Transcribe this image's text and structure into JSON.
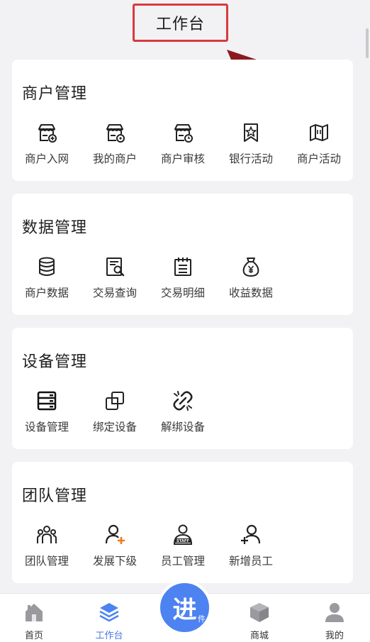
{
  "header": {
    "title": "工作台"
  },
  "sections": [
    {
      "title": "商户管理",
      "items": [
        {
          "label": "商户入网",
          "icon": "store-add-icon"
        },
        {
          "label": "我的商户",
          "icon": "store-gear-icon"
        },
        {
          "label": "商户审核",
          "icon": "store-clock-icon"
        },
        {
          "label": "银行活动",
          "icon": "star-flag-icon"
        },
        {
          "label": "商户活动",
          "icon": "map-icon"
        }
      ]
    },
    {
      "title": "数据管理",
      "items": [
        {
          "label": "商户数据",
          "icon": "database-icon"
        },
        {
          "label": "交易查询",
          "icon": "search-document-icon"
        },
        {
          "label": "交易明细",
          "icon": "clipboard-list-icon"
        },
        {
          "label": "收益数据",
          "icon": "money-bag-icon"
        }
      ]
    },
    {
      "title": "设备管理",
      "items": [
        {
          "label": "设备管理",
          "icon": "server-icon"
        },
        {
          "label": "绑定设备",
          "icon": "link-squares-icon"
        },
        {
          "label": "解绑设备",
          "icon": "unlink-icon"
        }
      ]
    },
    {
      "title": "团队管理",
      "items": [
        {
          "label": "团队管理",
          "icon": "team-icon"
        },
        {
          "label": "发展下级",
          "icon": "user-plus-orange-icon"
        },
        {
          "label": "员工管理",
          "icon": "staff-icon"
        },
        {
          "label": "新增员工",
          "icon": "user-add-icon"
        }
      ]
    }
  ],
  "center_button": {
    "main": "进",
    "sub": "件"
  },
  "nav": [
    {
      "label": "首页",
      "icon": "home-icon"
    },
    {
      "label": "工作台",
      "icon": "layers-icon",
      "active": true
    },
    {
      "label": "商城",
      "icon": "cube-icon"
    },
    {
      "label": "我的",
      "icon": "user-icon"
    }
  ],
  "colors": {
    "accent": "#4d82f1",
    "highlight_box": "#d9393e",
    "arrow": "#8b1a1f",
    "badge_orange": "#f07a1a"
  }
}
